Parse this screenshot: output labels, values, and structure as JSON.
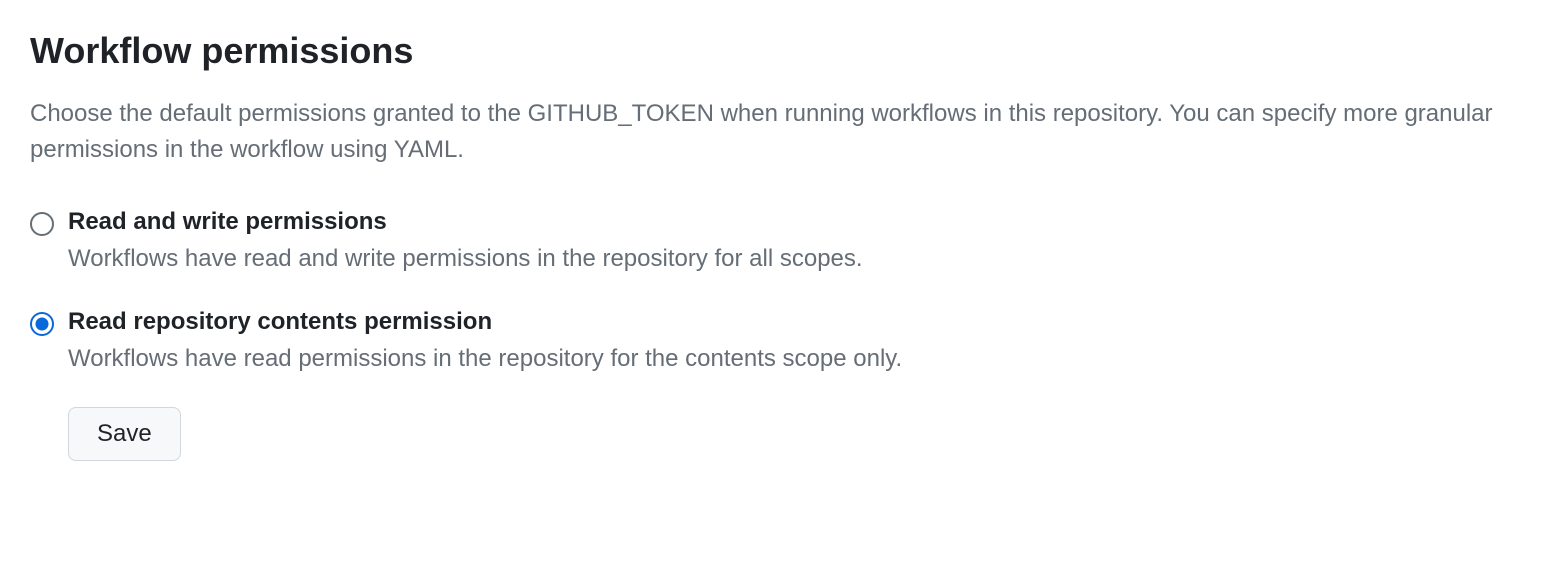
{
  "section": {
    "title": "Workflow permissions",
    "description": "Choose the default permissions granted to the GITHUB_TOKEN when running workflows in this repository. You can specify more granular permissions in the workflow using YAML."
  },
  "options": [
    {
      "label": "Read and write permissions",
      "description": "Workflows have read and write permissions in the repository for all scopes.",
      "checked": false
    },
    {
      "label": "Read repository contents permission",
      "description": "Workflows have read permissions in the repository for the contents scope only.",
      "checked": true
    }
  ],
  "actions": {
    "save_label": "Save"
  }
}
